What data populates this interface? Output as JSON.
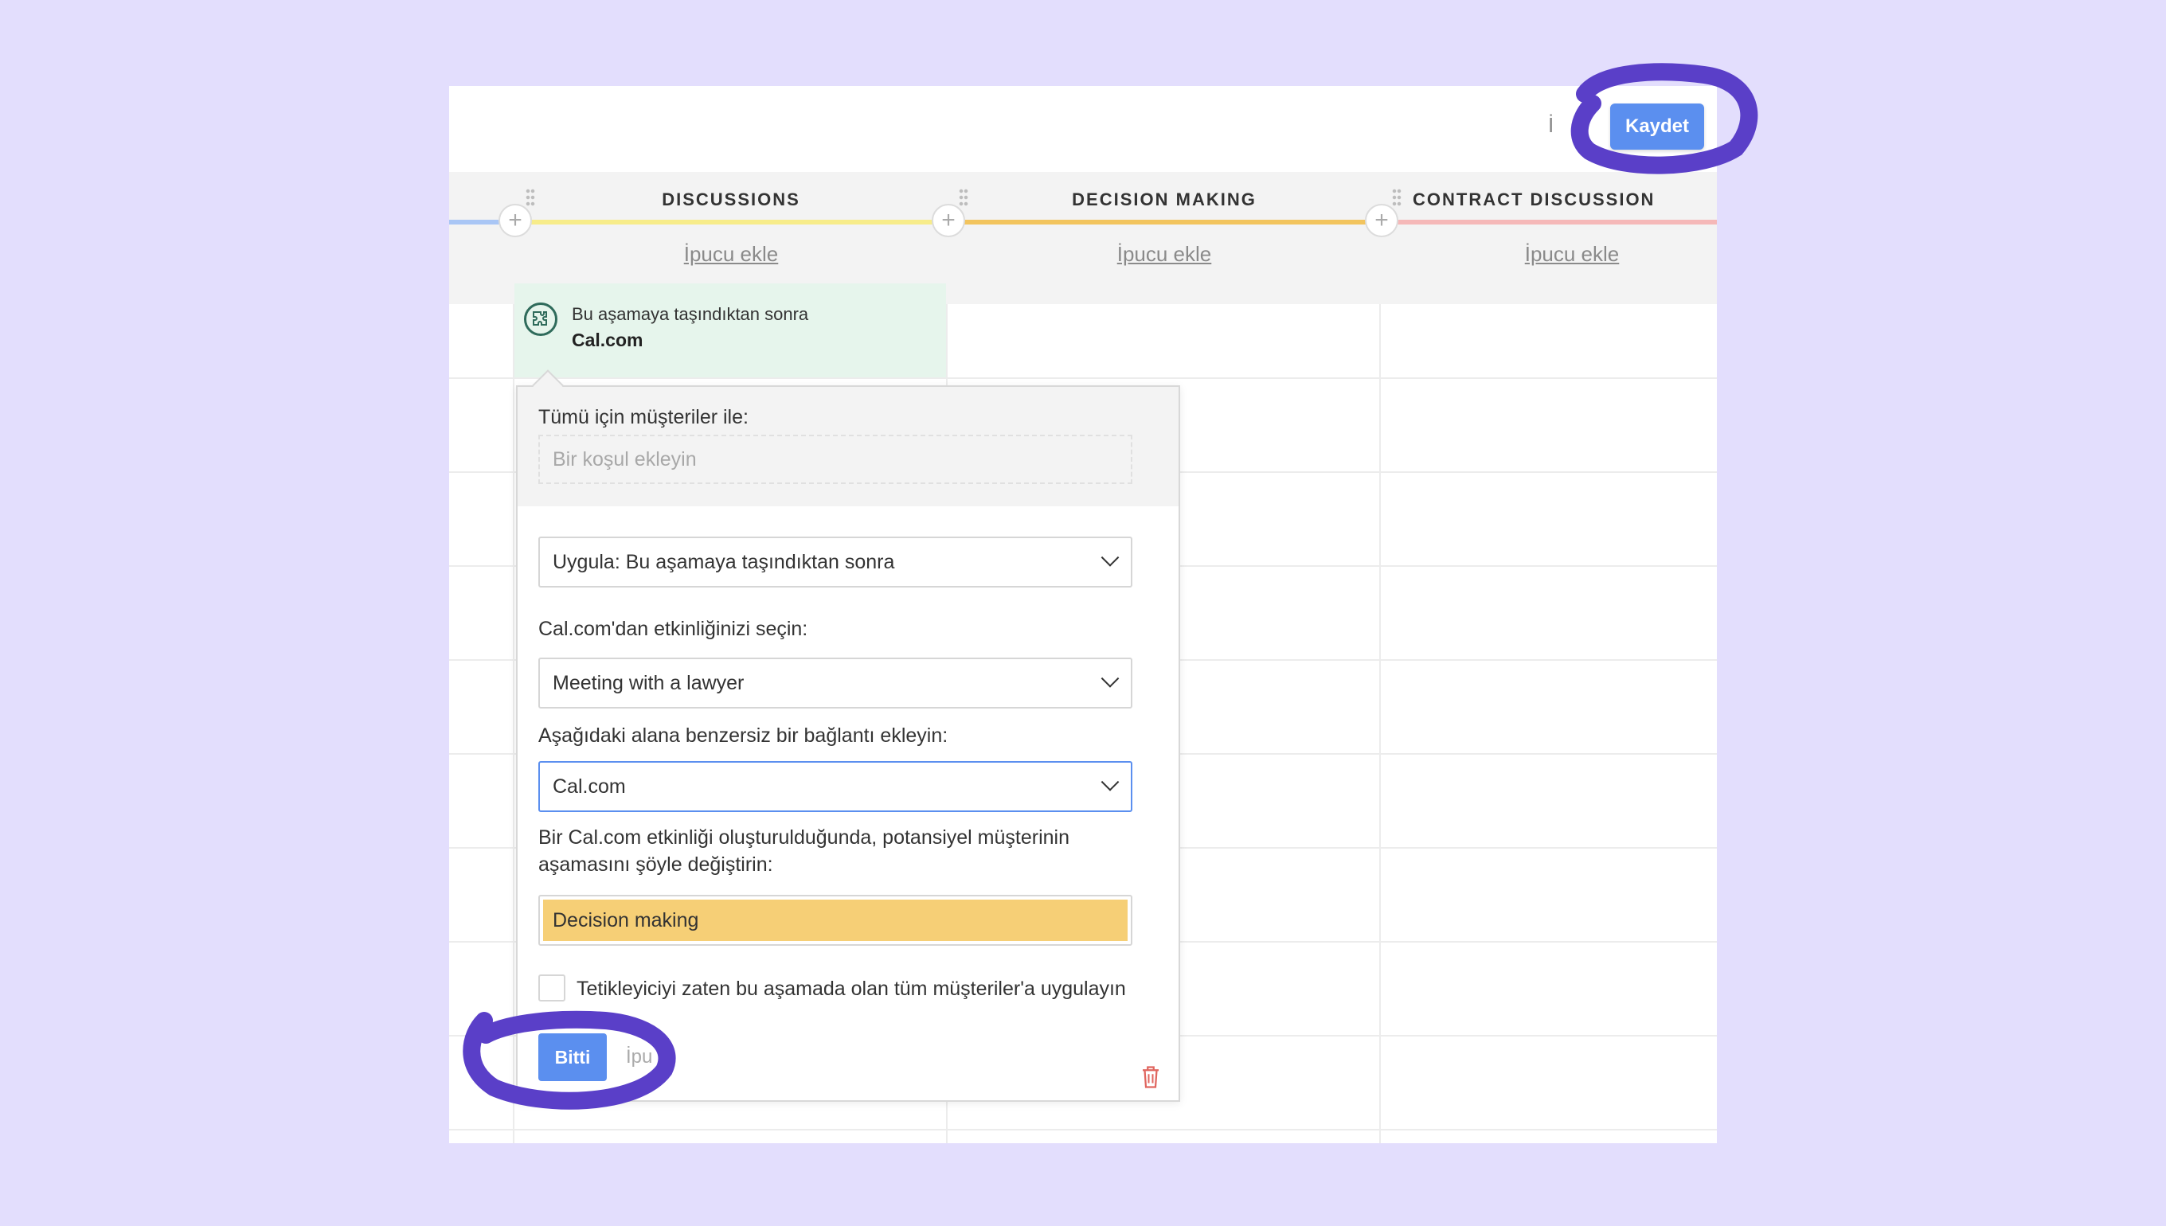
{
  "toolbar": {
    "cancel_partial": "İ",
    "save_label": "Kaydet"
  },
  "stages": [
    {
      "name": "DISCUSSIONS",
      "hint": "İpucu ekle",
      "color": "#f7ec8a"
    },
    {
      "name": "DECISION MAKING",
      "hint": "İpucu ekle",
      "color": "#f2c45e"
    },
    {
      "name": "CONTRACT DISCUSSION",
      "hint": "İpucu ekle",
      "color": "#f5b8b8"
    }
  ],
  "prev_stage_color": "#a9c6f5",
  "trigger": {
    "title": "Bu aşamaya taşındıktan sonra",
    "name": "Cal.com"
  },
  "popover": {
    "condition_label": "Tümü için müşteriler ile:",
    "condition_placeholder": "Bir koşul ekleyin",
    "apply_value": "Uygula: Bu aşamaya taşındıktan sonra",
    "event_label": "Cal.com'dan etkinliğinizi seçin:",
    "event_value": "Meeting with a lawyer",
    "link_label": "Aşağıdaki alana benzersiz bir bağlantı ekleyin:",
    "link_value": "Cal.com",
    "stage_label_line1": "Bir Cal.com etkinliği oluşturulduğunda, potansiyel müşterinin",
    "stage_label_line2": "aşamasını şöyle değiştirin:",
    "stage_value": "Decision making",
    "checkbox_label": "Tetikleyiciyi zaten bu aşamada olan tüm müşteriler'a uygulayın",
    "done_label": "Bitti",
    "cancel_partial": "İpu"
  },
  "colors": {
    "accent": "#5b8fef",
    "annotation": "#5a3fc8",
    "trigger_bg": "#e6f5ec"
  }
}
